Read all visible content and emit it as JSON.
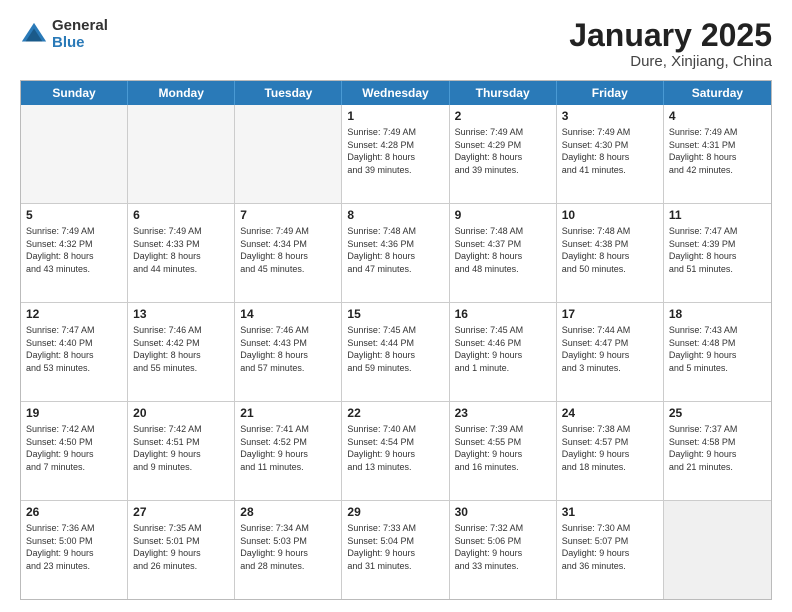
{
  "logo": {
    "general": "General",
    "blue": "Blue"
  },
  "header": {
    "title": "January 2025",
    "subtitle": "Dure, Xinjiang, China"
  },
  "weekdays": [
    "Sunday",
    "Monday",
    "Tuesday",
    "Wednesday",
    "Thursday",
    "Friday",
    "Saturday"
  ],
  "weeks": [
    [
      {
        "day": "",
        "text": "",
        "empty": true
      },
      {
        "day": "",
        "text": "",
        "empty": true
      },
      {
        "day": "",
        "text": "",
        "empty": true
      },
      {
        "day": "1",
        "text": "Sunrise: 7:49 AM\nSunset: 4:28 PM\nDaylight: 8 hours\nand 39 minutes."
      },
      {
        "day": "2",
        "text": "Sunrise: 7:49 AM\nSunset: 4:29 PM\nDaylight: 8 hours\nand 39 minutes."
      },
      {
        "day": "3",
        "text": "Sunrise: 7:49 AM\nSunset: 4:30 PM\nDaylight: 8 hours\nand 41 minutes."
      },
      {
        "day": "4",
        "text": "Sunrise: 7:49 AM\nSunset: 4:31 PM\nDaylight: 8 hours\nand 42 minutes."
      }
    ],
    [
      {
        "day": "5",
        "text": "Sunrise: 7:49 AM\nSunset: 4:32 PM\nDaylight: 8 hours\nand 43 minutes."
      },
      {
        "day": "6",
        "text": "Sunrise: 7:49 AM\nSunset: 4:33 PM\nDaylight: 8 hours\nand 44 minutes."
      },
      {
        "day": "7",
        "text": "Sunrise: 7:49 AM\nSunset: 4:34 PM\nDaylight: 8 hours\nand 45 minutes."
      },
      {
        "day": "8",
        "text": "Sunrise: 7:48 AM\nSunset: 4:36 PM\nDaylight: 8 hours\nand 47 minutes."
      },
      {
        "day": "9",
        "text": "Sunrise: 7:48 AM\nSunset: 4:37 PM\nDaylight: 8 hours\nand 48 minutes."
      },
      {
        "day": "10",
        "text": "Sunrise: 7:48 AM\nSunset: 4:38 PM\nDaylight: 8 hours\nand 50 minutes."
      },
      {
        "day": "11",
        "text": "Sunrise: 7:47 AM\nSunset: 4:39 PM\nDaylight: 8 hours\nand 51 minutes."
      }
    ],
    [
      {
        "day": "12",
        "text": "Sunrise: 7:47 AM\nSunset: 4:40 PM\nDaylight: 8 hours\nand 53 minutes."
      },
      {
        "day": "13",
        "text": "Sunrise: 7:46 AM\nSunset: 4:42 PM\nDaylight: 8 hours\nand 55 minutes."
      },
      {
        "day": "14",
        "text": "Sunrise: 7:46 AM\nSunset: 4:43 PM\nDaylight: 8 hours\nand 57 minutes."
      },
      {
        "day": "15",
        "text": "Sunrise: 7:45 AM\nSunset: 4:44 PM\nDaylight: 8 hours\nand 59 minutes."
      },
      {
        "day": "16",
        "text": "Sunrise: 7:45 AM\nSunset: 4:46 PM\nDaylight: 9 hours\nand 1 minute."
      },
      {
        "day": "17",
        "text": "Sunrise: 7:44 AM\nSunset: 4:47 PM\nDaylight: 9 hours\nand 3 minutes."
      },
      {
        "day": "18",
        "text": "Sunrise: 7:43 AM\nSunset: 4:48 PM\nDaylight: 9 hours\nand 5 minutes."
      }
    ],
    [
      {
        "day": "19",
        "text": "Sunrise: 7:42 AM\nSunset: 4:50 PM\nDaylight: 9 hours\nand 7 minutes."
      },
      {
        "day": "20",
        "text": "Sunrise: 7:42 AM\nSunset: 4:51 PM\nDaylight: 9 hours\nand 9 minutes."
      },
      {
        "day": "21",
        "text": "Sunrise: 7:41 AM\nSunset: 4:52 PM\nDaylight: 9 hours\nand 11 minutes."
      },
      {
        "day": "22",
        "text": "Sunrise: 7:40 AM\nSunset: 4:54 PM\nDaylight: 9 hours\nand 13 minutes."
      },
      {
        "day": "23",
        "text": "Sunrise: 7:39 AM\nSunset: 4:55 PM\nDaylight: 9 hours\nand 16 minutes."
      },
      {
        "day": "24",
        "text": "Sunrise: 7:38 AM\nSunset: 4:57 PM\nDaylight: 9 hours\nand 18 minutes."
      },
      {
        "day": "25",
        "text": "Sunrise: 7:37 AM\nSunset: 4:58 PM\nDaylight: 9 hours\nand 21 minutes."
      }
    ],
    [
      {
        "day": "26",
        "text": "Sunrise: 7:36 AM\nSunset: 5:00 PM\nDaylight: 9 hours\nand 23 minutes."
      },
      {
        "day": "27",
        "text": "Sunrise: 7:35 AM\nSunset: 5:01 PM\nDaylight: 9 hours\nand 26 minutes."
      },
      {
        "day": "28",
        "text": "Sunrise: 7:34 AM\nSunset: 5:03 PM\nDaylight: 9 hours\nand 28 minutes."
      },
      {
        "day": "29",
        "text": "Sunrise: 7:33 AM\nSunset: 5:04 PM\nDaylight: 9 hours\nand 31 minutes."
      },
      {
        "day": "30",
        "text": "Sunrise: 7:32 AM\nSunset: 5:06 PM\nDaylight: 9 hours\nand 33 minutes."
      },
      {
        "day": "31",
        "text": "Sunrise: 7:30 AM\nSunset: 5:07 PM\nDaylight: 9 hours\nand 36 minutes."
      },
      {
        "day": "",
        "text": "",
        "empty": true,
        "shaded": true
      }
    ]
  ]
}
